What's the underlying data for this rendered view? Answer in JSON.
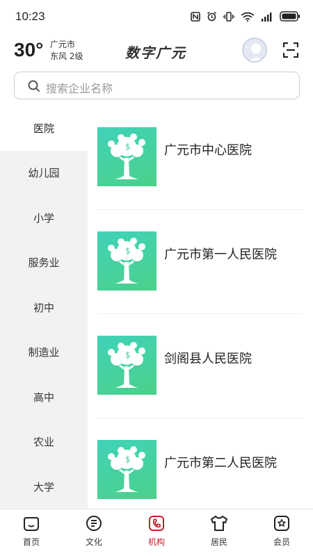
{
  "status_bar": {
    "time": "10:23",
    "icons": [
      "nfc-icon",
      "alarm-icon",
      "vibrate-icon",
      "wifi-icon",
      "signal-icon",
      "battery-icon"
    ]
  },
  "header": {
    "temperature": "30°",
    "city": "广元市",
    "wind": "东风  2级",
    "app_title": "数字广元"
  },
  "search": {
    "placeholder": "搜索企业名称"
  },
  "categories": {
    "active_index": 0,
    "items": [
      "医院",
      "幼儿园",
      "小学",
      "服务业",
      "初中",
      "制造业",
      "高中",
      "农业",
      "大学"
    ]
  },
  "results": {
    "items": [
      {
        "name": "广元市中心医院",
        "thumb_icon": "money-tree-icon"
      },
      {
        "name": "广元市第一人民医院",
        "thumb_icon": "money-tree-icon"
      },
      {
        "name": "剑阁县人民医院",
        "thumb_icon": "money-tree-icon"
      },
      {
        "name": "广元市第二人民医院",
        "thumb_icon": "money-tree-icon"
      }
    ]
  },
  "bottom_nav": {
    "active_index": 2,
    "active_color": "#c0202a",
    "items": [
      {
        "label": "首页",
        "icon": "home-icon"
      },
      {
        "label": "文化",
        "icon": "culture-icon"
      },
      {
        "label": "机构",
        "icon": "institution-icon"
      },
      {
        "label": "居民",
        "icon": "resident-icon"
      },
      {
        "label": "会员",
        "icon": "member-icon"
      }
    ]
  },
  "colors": {
    "thumb_gradient_start": "#3fd3b8",
    "thumb_gradient_end": "#4cd08a",
    "sidebar_bg": "#f2f2f2"
  }
}
